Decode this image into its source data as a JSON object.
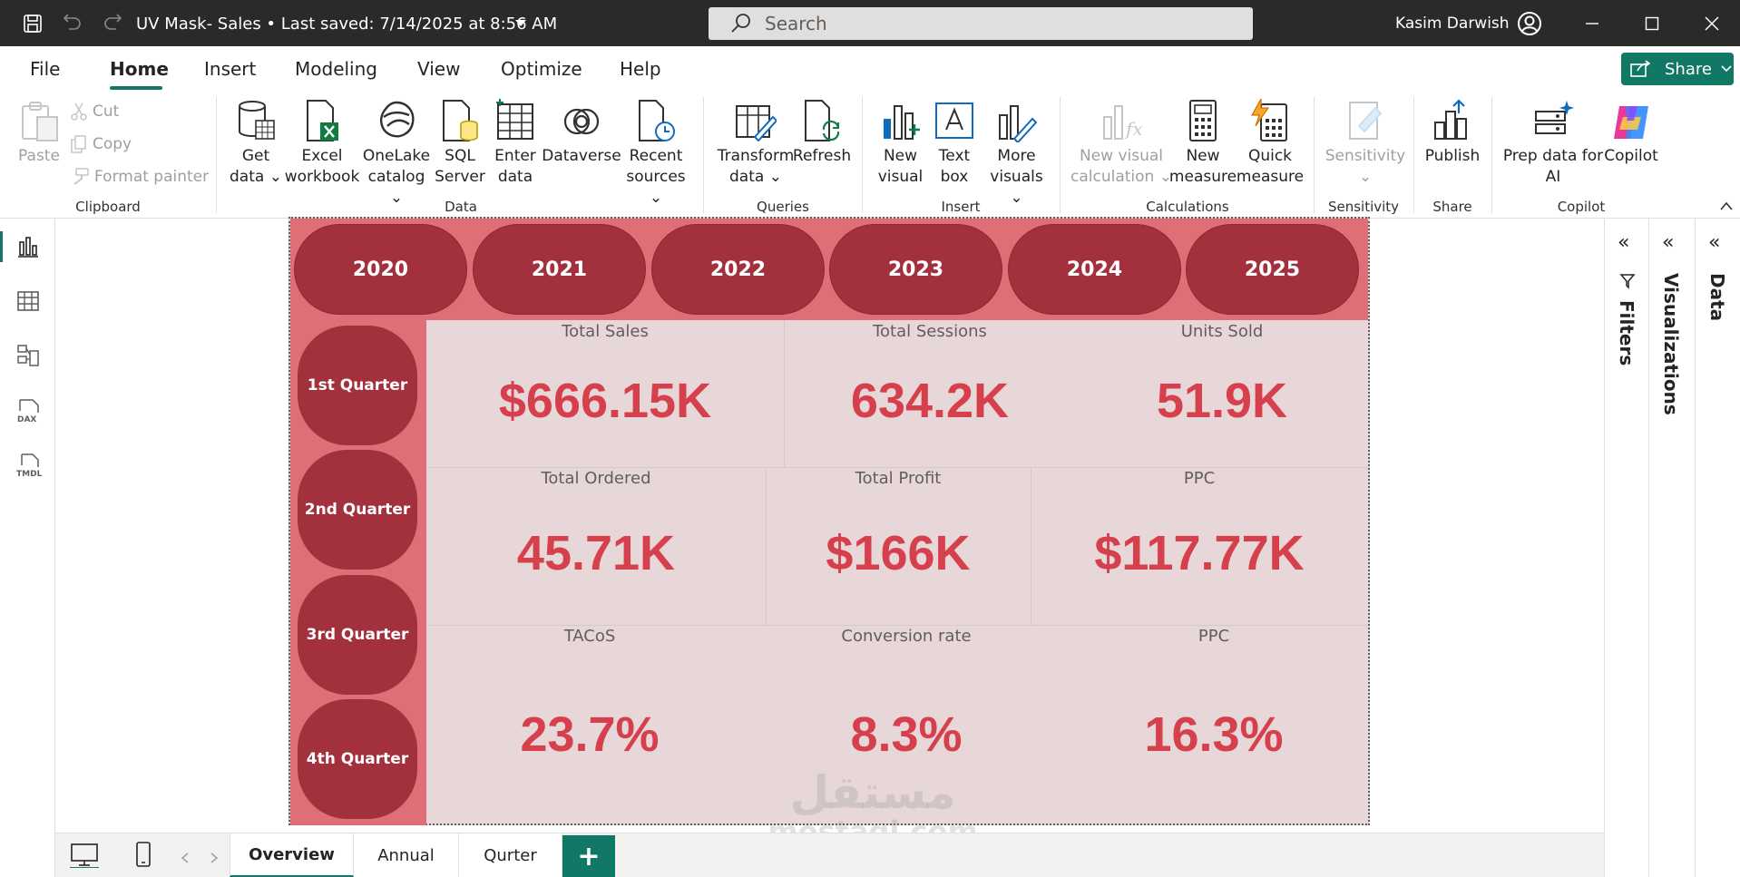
{
  "titlebar": {
    "title": "UV Mask- Sales • Last saved: 7/14/2025 at 8:56 AM",
    "search_placeholder": "Search",
    "user": "Kasim Darwish"
  },
  "menu": {
    "items": [
      "File",
      "Home",
      "Insert",
      "Modeling",
      "View",
      "Optimize",
      "Help"
    ],
    "active": "Home",
    "share_label": "Share"
  },
  "ribbon": {
    "clipboard": {
      "paste": "Paste",
      "cut": "Cut",
      "copy": "Copy",
      "format_painter": "Format painter",
      "group": "Clipboard"
    },
    "data": {
      "get_data": [
        "Get",
        "data ⌄"
      ],
      "excel": [
        "Excel",
        "workbook"
      ],
      "onelake": [
        "OneLake",
        "catalog ⌄"
      ],
      "sql": [
        "SQL",
        "Server"
      ],
      "enter": [
        "Enter",
        "data"
      ],
      "dataverse": [
        "Dataverse"
      ],
      "recent": [
        "Recent",
        "sources ⌄"
      ],
      "group": "Data"
    },
    "queries": {
      "transform": [
        "Transform",
        "data ⌄"
      ],
      "refresh": [
        "Refresh"
      ],
      "group": "Queries"
    },
    "insert": {
      "new_visual": [
        "New",
        "visual"
      ],
      "text_box": [
        "Text",
        "box"
      ],
      "more_visuals": [
        "More",
        "visuals ⌄"
      ],
      "group": "Insert"
    },
    "calculations": {
      "new_visual_calc": [
        "New visual",
        "calculation ⌄"
      ],
      "new_measure": [
        "New",
        "measure"
      ],
      "quick_measure": [
        "Quick",
        "measure"
      ],
      "group": "Calculations"
    },
    "sensitivity": {
      "label": [
        "Sensitivity",
        "⌄"
      ],
      "group": "Sensitivity"
    },
    "share": {
      "publish": [
        "Publish"
      ],
      "group": "Share"
    },
    "copilot": {
      "prep": [
        "Prep data for",
        "AI"
      ],
      "copilot": [
        "Copilot"
      ],
      "group": "Copilot"
    }
  },
  "panes": {
    "filters": "Filters",
    "visualizations": "Visualizations",
    "data": "Data"
  },
  "report": {
    "years": [
      "2020",
      "2021",
      "2022",
      "2023",
      "2024",
      "2025"
    ],
    "quarters": [
      "1st Quarter",
      "2nd Quarter",
      "3rd Quarter",
      "4th Quarter"
    ],
    "cards": {
      "total_sales": {
        "label": "Total Sales",
        "value": "$666.15K"
      },
      "total_sessions": {
        "label": "Total Sessions",
        "value": "634.2K"
      },
      "units_sold": {
        "label": "Units Sold",
        "value": "51.9K"
      },
      "total_ordered": {
        "label": "Total Ordered",
        "value": "45.71K"
      },
      "total_profit": {
        "label": "Total Profit",
        "value": "$166K"
      },
      "ppc": {
        "label": "PPC",
        "value": "$117.77K"
      },
      "tacos": {
        "label": "TACoS",
        "value": "23.7%"
      },
      "conversion_rate": {
        "label": "Conversion rate",
        "value": "8.3%"
      },
      "ppc_pct": {
        "label": "PPC",
        "value": "16.3%"
      }
    },
    "watermark": {
      "arabic": "مستقل",
      "latin": "mostaql.com"
    }
  },
  "pages": {
    "tabs": [
      "Overview",
      "Annual",
      "Qurter"
    ],
    "active": "Overview",
    "add": "+"
  },
  "colors": {
    "accent": "#117865",
    "year_band": "#df6e76",
    "button": "#a3303d",
    "value": "#d6404d",
    "card_bg": "#e7d7d8"
  }
}
